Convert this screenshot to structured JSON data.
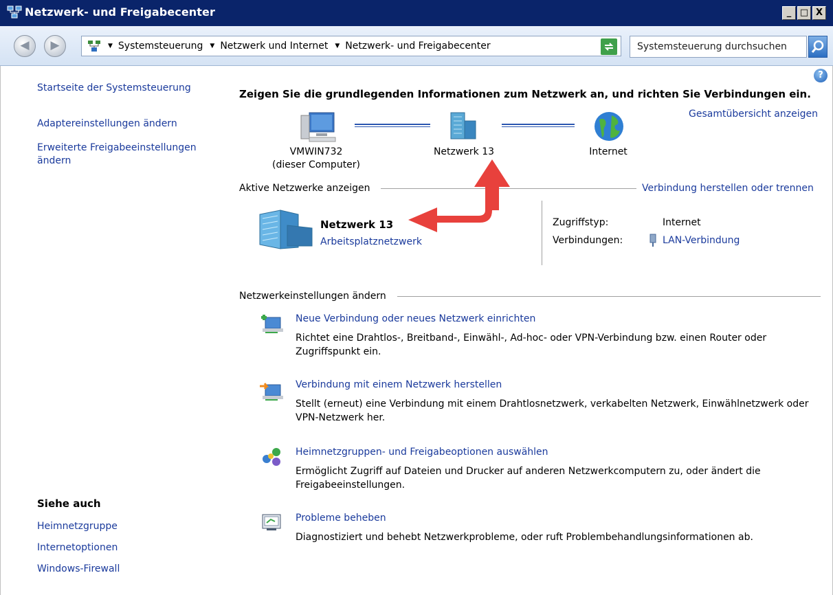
{
  "window": {
    "title": "Netzwerk- und Freigabecenter",
    "controls": {
      "minimize": "_",
      "maximize": "□",
      "close": "X"
    }
  },
  "address_bar": {
    "breadcrumbs": [
      "Systemsteuerung",
      "Netzwerk und Internet",
      "Netzwerk- und Freigabecenter"
    ],
    "search_placeholder": "Systemsteuerung durchsuchen"
  },
  "sidebar": {
    "home": "Startseite der Systemsteuerung",
    "links": [
      "Adaptereinstellungen ändern",
      "Erweiterte Freigabeeinstellungen ändern"
    ],
    "see_also_heading": "Siehe auch",
    "see_also": [
      "Heimnetzgruppe",
      "Internetoptionen",
      "Windows-Firewall"
    ]
  },
  "main": {
    "heading": "Zeigen Sie die grundlegenden Informationen zum Netzwerk an, und richten Sie Verbindungen ein.",
    "overview_link": "Gesamtübersicht anzeigen",
    "map": {
      "computer_name": "VMWIN732",
      "computer_sub": "(dieser Computer)",
      "network": "Netzwerk 13",
      "internet": "Internet"
    },
    "active_networks": {
      "heading": "Aktive Netzwerke anzeigen",
      "connect_link": "Verbindung herstellen oder trennen",
      "network_name": "Netzwerk 13",
      "network_type": "Arbeitsplatznetzwerk",
      "access_label": "Zugriffstyp:",
      "access_value": "Internet",
      "connections_label": "Verbindungen:",
      "connections_value": "LAN-Verbindung"
    },
    "settings": {
      "heading": "Netzwerkeinstellungen ändern",
      "items": [
        {
          "title": "Neue Verbindung oder neues Netzwerk einrichten",
          "desc": "Richtet eine Drahtlos-, Breitband-, Einwähl-, Ad-hoc- oder VPN-Verbindung bzw. einen Router oder Zugriffspunkt ein."
        },
        {
          "title": "Verbindung mit einem Netzwerk herstellen",
          "desc": "Stellt (erneut) eine Verbindung mit einem Drahtlosnetzwerk, verkabelten Netzwerk, Einwählnetzwerk oder VPN-Netzwerk her."
        },
        {
          "title": "Heimnetzgruppen- und Freigabeoptionen auswählen",
          "desc": "Ermöglicht Zugriff auf Dateien und Drucker auf anderen Netzwerkcomputern zu, oder ändert die Freigabeeinstellungen."
        },
        {
          "title": "Probleme beheben",
          "desc": "Diagnostiziert und behebt Netzwerkprobleme, oder ruft Problembehandlungsinformationen ab."
        }
      ]
    }
  },
  "colors": {
    "titlebar": "#0a246a",
    "link": "#1a3a9c",
    "annotation_arrow": "#e8413c"
  }
}
